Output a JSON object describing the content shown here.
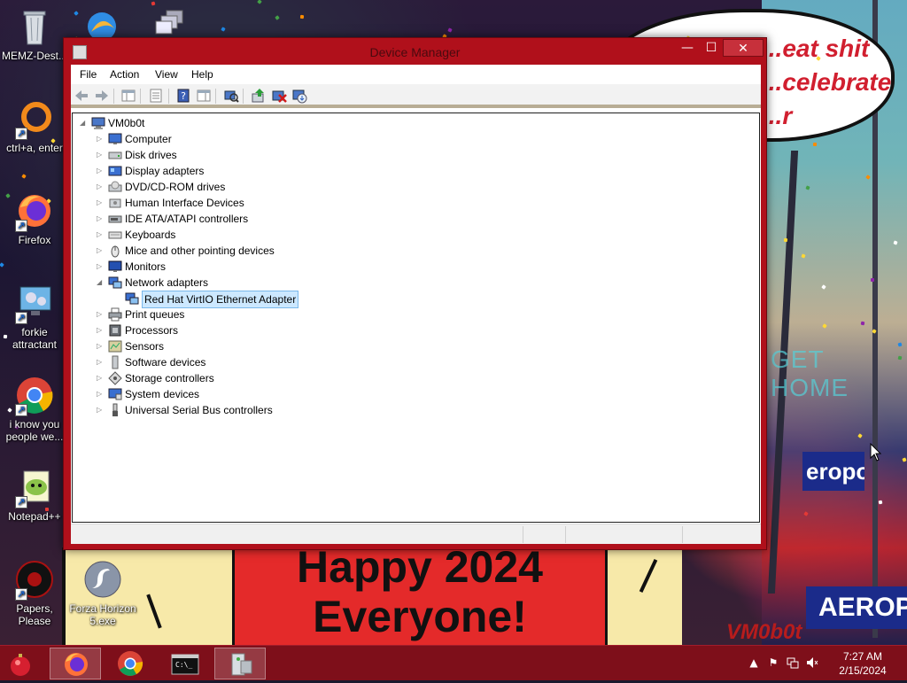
{
  "desktop": {
    "icons": [
      {
        "label": "MEMZ-Dest..."
      },
      {
        "label": "ctrl+a, enter"
      },
      {
        "label": "Firefox"
      },
      {
        "label": "forkie attractant"
      },
      {
        "label": "i know you people we..."
      },
      {
        "label": "Notepad++"
      },
      {
        "label": "Papers, Please"
      },
      {
        "label": "Forza Horizon 5.exe"
      }
    ],
    "wallpaper": {
      "bubble_line1": "...eat shit",
      "bubble_line2": "...celebrate",
      "bubble_line3": "...r",
      "comic_line1": "Happy 2024",
      "comic_line2": "Everyone!",
      "sign_aero_small": "eropo",
      "sign_aero_big": "AEROPOS",
      "get_home": "GET HOME",
      "signature": "VM0b0t"
    }
  },
  "window": {
    "title": "Device Manager",
    "menu": [
      "File",
      "Action",
      "View",
      "Help"
    ],
    "tree": {
      "root": "VM0b0t",
      "categories": [
        {
          "label": "Computer",
          "icon": "computer-icon"
        },
        {
          "label": "Disk drives",
          "icon": "disk-drive-icon"
        },
        {
          "label": "Display adapters",
          "icon": "display-adapter-icon"
        },
        {
          "label": "DVD/CD-ROM drives",
          "icon": "dvd-drive-icon"
        },
        {
          "label": "Human Interface Devices",
          "icon": "hid-icon"
        },
        {
          "label": "IDE ATA/ATAPI controllers",
          "icon": "ide-controller-icon"
        },
        {
          "label": "Keyboards",
          "icon": "keyboard-icon"
        },
        {
          "label": "Mice and other pointing devices",
          "icon": "mouse-icon"
        },
        {
          "label": "Monitors",
          "icon": "monitor-icon"
        },
        {
          "label": "Network adapters",
          "icon": "network-adapter-icon",
          "expanded": true,
          "children": [
            {
              "label": "Red Hat VirtIO Ethernet Adapter",
              "selected": true
            }
          ]
        },
        {
          "label": "Print queues",
          "icon": "printer-icon"
        },
        {
          "label": "Processors",
          "icon": "processor-icon"
        },
        {
          "label": "Sensors",
          "icon": "sensor-icon"
        },
        {
          "label": "Software devices",
          "icon": "software-device-icon"
        },
        {
          "label": "Storage controllers",
          "icon": "storage-controller-icon"
        },
        {
          "label": "System devices",
          "icon": "system-device-icon"
        },
        {
          "label": "Universal Serial Bus controllers",
          "icon": "usb-icon"
        }
      ]
    }
  },
  "taskbar": {
    "apps": [
      "firefox-icon",
      "chrome-icon",
      "command-prompt-icon",
      "device-manager-icon"
    ],
    "clock": {
      "time": "7:27 AM",
      "date": "2/15/2024"
    }
  },
  "colors": {
    "window_frame": "#b0101b",
    "taskbar": "#7e0f1a",
    "selection_bg": "#cce8ff",
    "selection_border": "#7ab8ea"
  }
}
